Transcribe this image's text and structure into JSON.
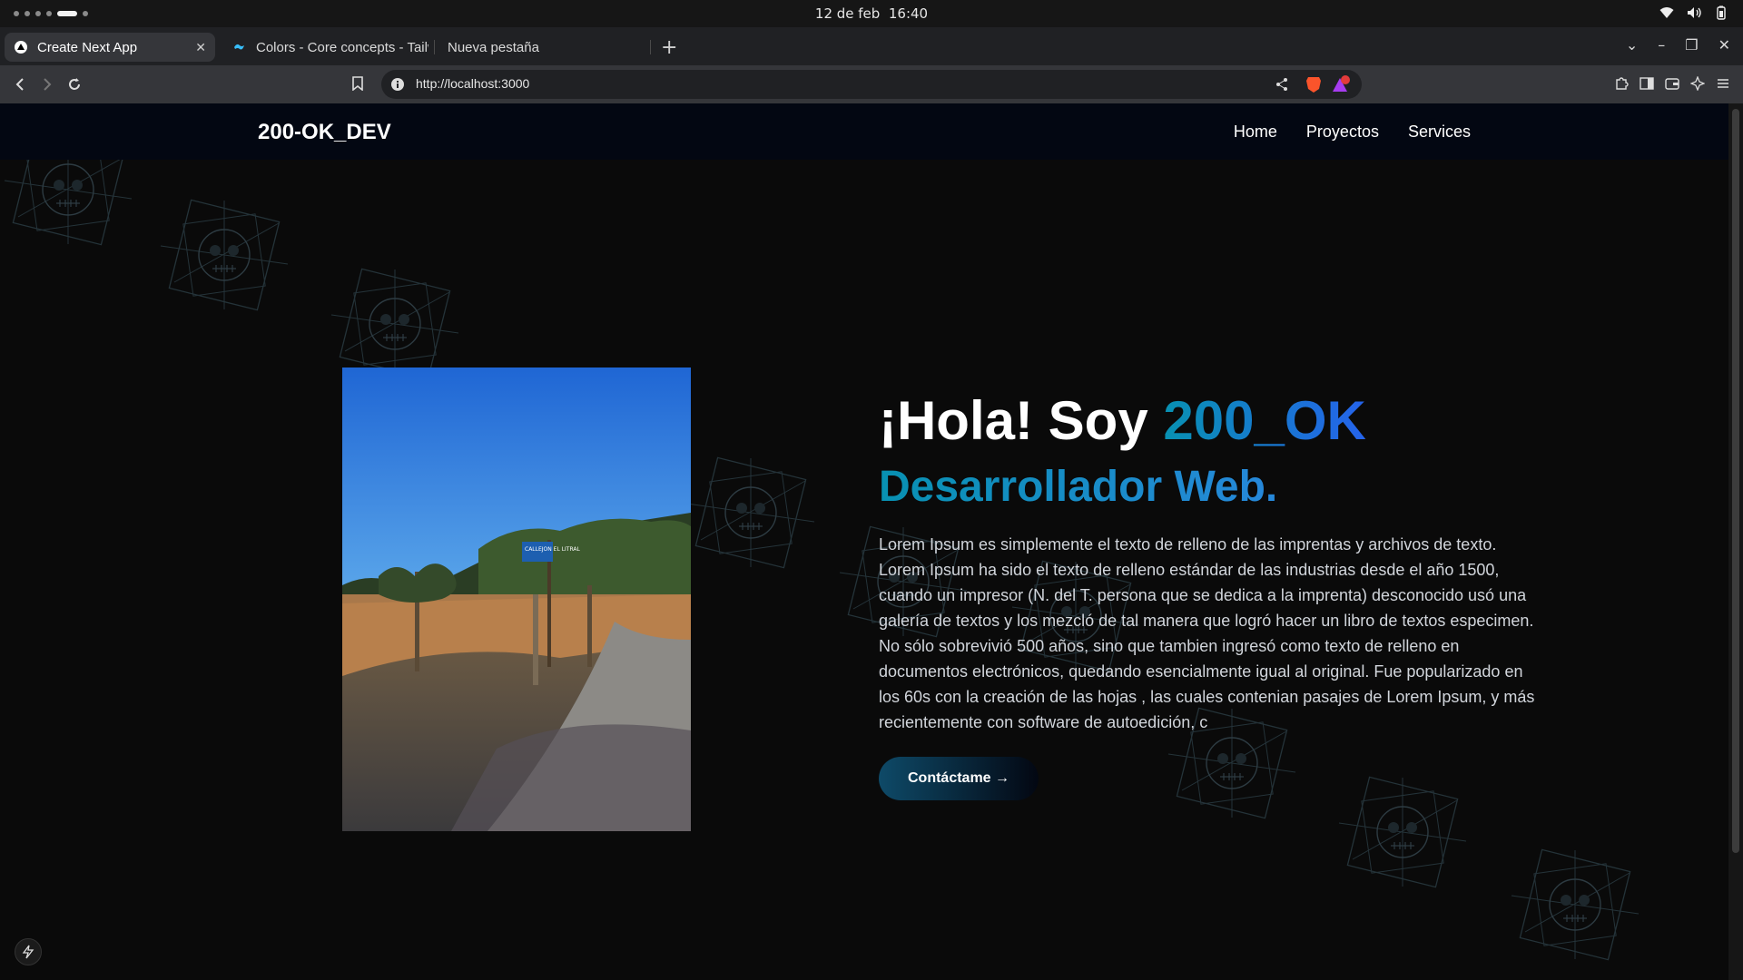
{
  "system": {
    "date": "12 de feb",
    "time": "16:40"
  },
  "tabs": [
    {
      "label": "Create Next App",
      "active": true
    },
    {
      "label": "Colors - Core concepts - Tailw",
      "active": false
    },
    {
      "label": "Nueva pestaña",
      "active": false
    }
  ],
  "address_bar": {
    "url": "http://localhost:3000",
    "rewards_badge": "1"
  },
  "site": {
    "brand": "200-OK_DEV",
    "nav": [
      "Home",
      "Proyectos",
      "Services"
    ],
    "hero": {
      "greeting": "¡Hola! Soy ",
      "name": "200_OK",
      "role": "Desarrollador Web.",
      "description": "Lorem Ipsum es simplemente el texto de relleno de las imprentas y archivos de texto. Lorem Ipsum ha sido el texto de relleno estándar de las industrias desde el año 1500, cuando un impresor (N. del T. persona que se dedica a la imprenta) desconocido usó una galería de textos y los mezcló de tal manera que logró hacer un libro de textos especimen. No sólo sobrevivió 500 años, sino que tambien ingresó como texto de relleno en documentos electrónicos, quedando esencialmente igual al original. Fue popularizado en los 60s con la creación de las hojas , las cuales contenian pasajes de Lorem Ipsum, y más recientemente con software de autoedición, c",
      "cta": "Contáctame →",
      "sign_text": "CALLEJON EL LITRAL"
    }
  },
  "colors": {
    "accent_start": "#0891b2",
    "accent_end": "#2563eb",
    "header_bg": "#030712",
    "page_bg": "#0a0a0a"
  }
}
